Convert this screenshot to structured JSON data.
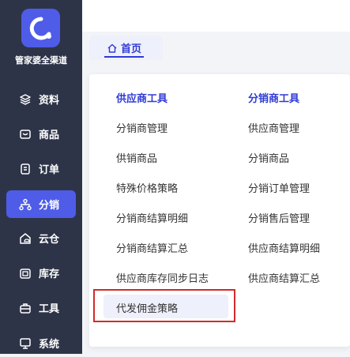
{
  "brand": {
    "name": "管家婆全渠道"
  },
  "sidebar": {
    "items": [
      {
        "label": "资料",
        "icon": "layers-icon",
        "active": false
      },
      {
        "label": "商品",
        "icon": "box-icon",
        "active": false
      },
      {
        "label": "订单",
        "icon": "document-icon",
        "active": false
      },
      {
        "label": "分销",
        "icon": "network-icon",
        "active": true
      },
      {
        "label": "云仓",
        "icon": "cloud-warehouse-icon",
        "active": false
      },
      {
        "label": "库存",
        "icon": "inventory-icon",
        "active": false
      },
      {
        "label": "工具",
        "icon": "toolbox-icon",
        "active": false
      },
      {
        "label": "系统",
        "icon": "monitor-icon",
        "active": false
      }
    ]
  },
  "tabs": [
    {
      "label": "首页",
      "icon": "home-icon"
    }
  ],
  "menu": {
    "col1": {
      "title": "供应商工具",
      "items": [
        "分销商管理",
        "供销商品",
        "特殊价格策略",
        "分销商结算明细",
        "分销商结算汇总",
        "供应商库存同步日志",
        "代发佣金策略"
      ]
    },
    "col2": {
      "title": "分销商工具",
      "items": [
        "供应商管理",
        "分销商品",
        "分销订单管理",
        "分销售后管理",
        "供应商结算明细",
        "供应商结算汇总"
      ]
    }
  },
  "colors": {
    "accent": "#4e5ce8",
    "sidebar_bg": "#2e3448",
    "highlight": "#d42a2a",
    "link_active": "#2f3bd6"
  }
}
